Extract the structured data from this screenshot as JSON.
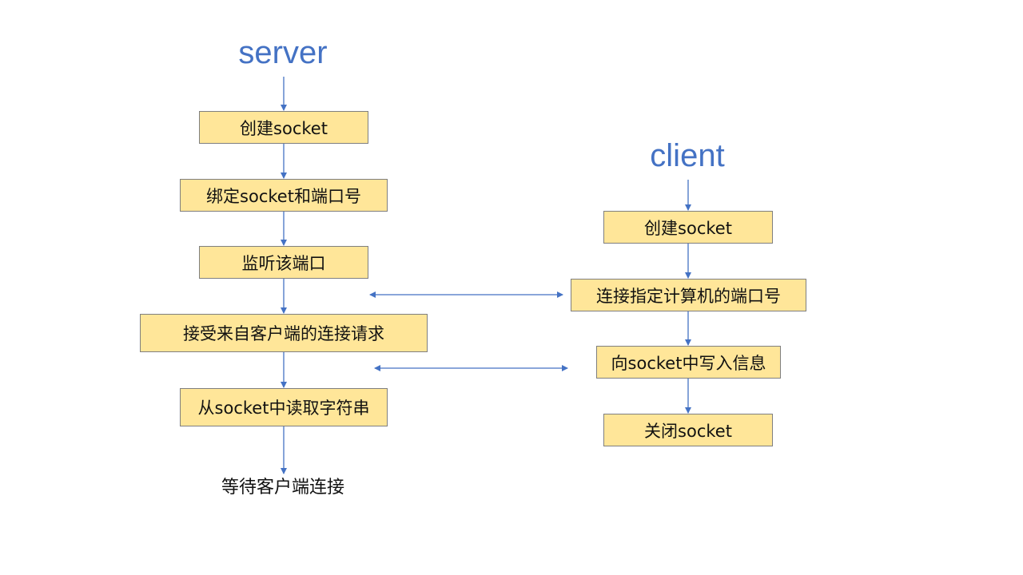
{
  "server": {
    "title": "server",
    "steps": [
      "创建socket",
      "绑定socket和端口号",
      "监听该端口",
      "接受来自客户端的连接请求",
      "从socket中读取字符串"
    ],
    "end_label": "等待客户端连接"
  },
  "client": {
    "title": "client",
    "steps": [
      "创建socket",
      "连接指定计算机的端口号",
      "向socket中写入信息",
      "关闭socket"
    ]
  },
  "colors": {
    "title": "#4472c4",
    "box_fill": "#ffe699",
    "box_border": "#7f7f7f",
    "arrow": "#4472c4"
  }
}
